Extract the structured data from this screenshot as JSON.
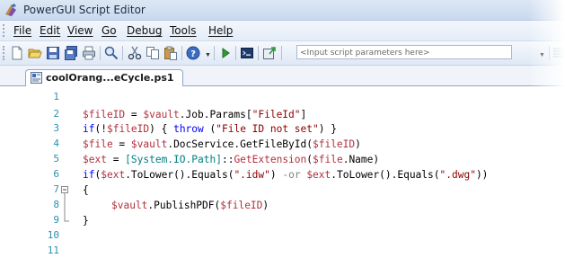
{
  "window": {
    "title": "PowerGUI Script Editor"
  },
  "menubar": {
    "items": [
      "File",
      "Edit",
      "View",
      "Go",
      "Debug",
      "Tools",
      "Help"
    ]
  },
  "toolbar": {
    "params_placeholder": "<Input script parameters here>",
    "buttons": [
      "new-icon",
      "open-icon",
      "save-icon",
      "save-all-icon",
      "print-icon",
      "find-icon",
      "cut-icon",
      "copy-icon",
      "paste-icon",
      "help-icon",
      "run-icon",
      "console-icon",
      "publish-icon"
    ]
  },
  "tabs": [
    {
      "label": "coolOrang...eCycle.ps1"
    }
  ],
  "editor": {
    "line_numbers": [
      "1",
      "2",
      "3",
      "4",
      "5",
      "6",
      "7",
      "8",
      "9",
      "10",
      "11"
    ]
  },
  "colors": {
    "variable": "#b0313e",
    "keyword": "#0000ff",
    "string": "#8b0000",
    "type": "#008080",
    "line_number": "#2b91af"
  }
}
